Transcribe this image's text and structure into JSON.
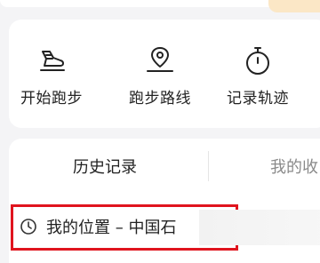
{
  "quick_actions": [
    {
      "label": "开始跑步",
      "icon": "running-shoe-icon"
    },
    {
      "label": "跑步路线",
      "icon": "route-pin-icon"
    },
    {
      "label": "记录轨迹",
      "icon": "stopwatch-icon"
    }
  ],
  "history": {
    "tabs": [
      {
        "label": "历史记录",
        "active": true
      },
      {
        "label": "我的收",
        "active": false
      }
    ],
    "items": [
      {
        "text": "我的位置 – 中国石",
        "icon": "clock-icon"
      }
    ]
  },
  "colors": {
    "highlight_border": "#e0141e",
    "badge": "#fbe7c6"
  }
}
